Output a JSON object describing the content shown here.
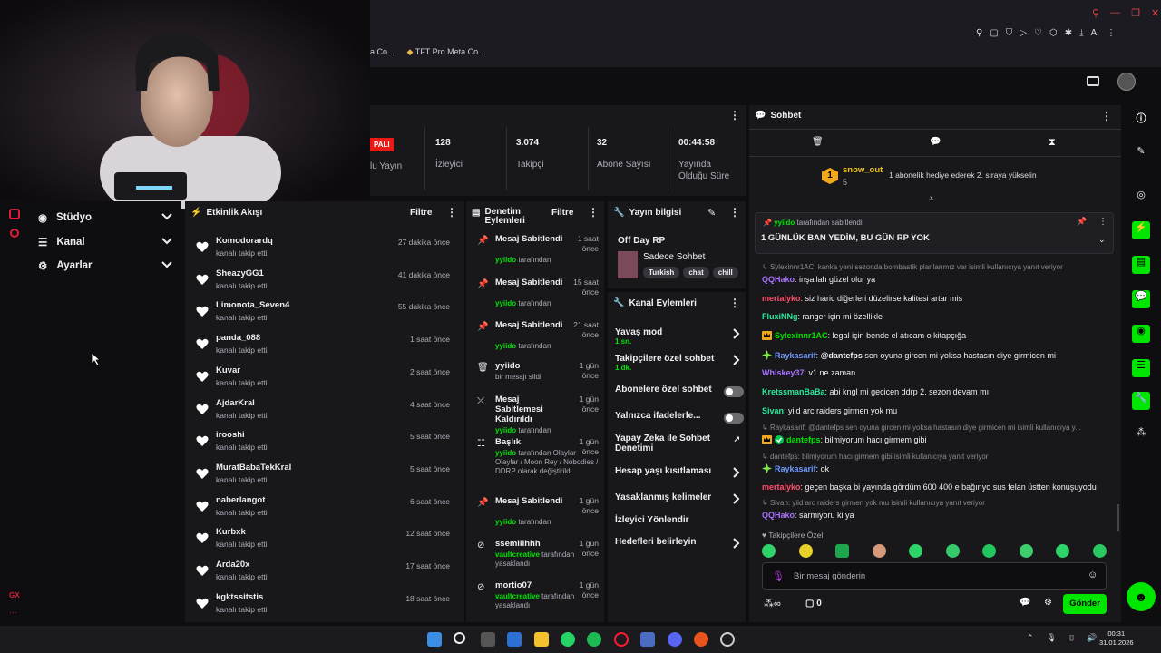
{
  "colors": {
    "accent": "#00e600",
    "purple": "#a970ff",
    "bg": "#0e0e10",
    "panel": "#18181b"
  },
  "browser": {
    "bookmarks": [
      "a Co...",
      "TFT Pro Meta Co..."
    ],
    "ai_label": "AI"
  },
  "stats": {
    "live_badge": "PALI",
    "live_label": "lu Yayın",
    "items": [
      {
        "value": "128",
        "label": "İzleyici"
      },
      {
        "value": "3.074",
        "label": "Takipçi"
      },
      {
        "value": "32",
        "label": "Abone Sayısı"
      },
      {
        "value": "00:44:58",
        "label": "Yayında Olduğu Süre"
      }
    ]
  },
  "nav": {
    "items": [
      {
        "label": "Stüdyo",
        "icon": "studio-icon"
      },
      {
        "label": "Kanal",
        "icon": "channel-icon"
      },
      {
        "label": "Ayarlar",
        "icon": "gear-icon"
      }
    ],
    "bottom_label": "GX"
  },
  "activity": {
    "title": "Etkinlik Akışı",
    "filter": "Filtre",
    "rows": [
      {
        "name": "Komodorardq",
        "sub": "kanalı takip etti",
        "time": "27 dakika önce"
      },
      {
        "name": "SheazyGG1",
        "sub": "kanalı takip etti",
        "time": "41 dakika önce"
      },
      {
        "name": "Limonota_Seven4",
        "sub": "kanalı takip etti",
        "time": "55 dakika önce"
      },
      {
        "name": "panda_088",
        "sub": "kanalı takip etti",
        "time": "1 saat önce"
      },
      {
        "name": "Kuvar",
        "sub": "kanalı takip etti",
        "time": "2 saat önce"
      },
      {
        "name": "AjdarKral",
        "sub": "kanalı takip etti",
        "time": "4 saat önce"
      },
      {
        "name": "irooshi",
        "sub": "kanalı takip etti",
        "time": "5 saat önce"
      },
      {
        "name": "MuratBabaTekKral",
        "sub": "kanalı takip etti",
        "time": "5 saat önce"
      },
      {
        "name": "naberlangot",
        "sub": "kanalı takip etti",
        "time": "6 saat önce"
      },
      {
        "name": "Kurbxk",
        "sub": "kanalı takip etti",
        "time": "12 saat önce"
      },
      {
        "name": "Arda20x",
        "sub": "kanalı takip etti",
        "time": "17 saat önce"
      },
      {
        "name": "kgktssitstis",
        "sub": "kanalı takip etti",
        "time": "18 saat önce"
      }
    ]
  },
  "moderation": {
    "title": "Denetim Eylemleri",
    "filter": "Filtre",
    "rows": [
      {
        "title": "Mesaj Sabitlendi",
        "time": "1 saat önce",
        "by_user": "yyiido",
        "by_rest": "tarafından",
        "icon": "pin-icon"
      },
      {
        "title": "Mesaj Sabitlendi",
        "time": "15 saat önce",
        "by_user": "yyiido",
        "by_rest": "tarafından",
        "icon": "pin-icon"
      },
      {
        "title": "Mesaj Sabitlendi",
        "time": "21 saat önce",
        "by_user": "yyiido",
        "by_rest": "tarafından",
        "icon": "pin-icon"
      },
      {
        "title": "yyiido",
        "time": "1 gün önce",
        "by_user": "",
        "by_rest": "bir mesajı sildi",
        "icon": "trash-icon"
      },
      {
        "title": "Mesaj Sabitlemesi Kaldırıldı",
        "time": "1 gün önce",
        "by_user": "yyiido",
        "by_rest": "tarafından",
        "icon": "unpin-icon"
      },
      {
        "title": "Başlık",
        "time": "1 gün önce",
        "by_user": "yyiido",
        "by_rest": "tarafından Olaylar Olaylar / Moon Rey / Nobodies / DDRP olarak değiştirildi",
        "icon": "title-icon"
      },
      {
        "title": "Mesaj Sabitlendi",
        "time": "1 gün önce",
        "by_user": "yyiido",
        "by_rest": "tarafından",
        "icon": "pin-icon"
      },
      {
        "title": "ssemiiihhh",
        "time": "1 gün önce",
        "by_user": "vaultcreative",
        "by_rest": "tarafından yasaklandı",
        "icon": "ban-icon"
      },
      {
        "title": "mortio07",
        "time": "1 gün önce",
        "by_user": "vaultcreative",
        "by_rest": "tarafından yasaklandı",
        "icon": "ban-icon"
      }
    ]
  },
  "stream_info": {
    "title": "Yayın bilgisi",
    "stream_title": "Off Day RP",
    "category": "Sadece Sohbet",
    "tags": [
      "Turkish",
      "chat",
      "chill"
    ]
  },
  "channel_actions": {
    "title": "Kanal Eylemleri",
    "items": [
      {
        "label": "Yavaş mod",
        "value": "1 sn.",
        "control": "arrow"
      },
      {
        "label": "Takipçilere özel sohbet",
        "value": "1 dk.",
        "control": "arrow"
      },
      {
        "label": "Abonelere özel sohbet",
        "value": "",
        "control": "toggle"
      },
      {
        "label": "Yalnızca ifadelerle...",
        "value": "",
        "control": "toggle"
      },
      {
        "label": "Yapay Zeka ile Sohbet Denetimi",
        "value": "",
        "control": "external"
      },
      {
        "label": "Hesap yaşı kısıtlaması",
        "value": "",
        "control": "arrow"
      },
      {
        "label": "Yasaklanmış kelimeler",
        "value": "",
        "control": "arrow"
      },
      {
        "label": "İzleyici Yönlendir",
        "value": "",
        "control": "none"
      },
      {
        "label": "Hedefleri belirleyin",
        "value": "",
        "control": "arrow"
      }
    ]
  },
  "chat": {
    "title": "Sohbet",
    "top_gifter": {
      "rank": "1",
      "name": "snow_out",
      "count": "5",
      "text": "1 abonelik hediye ederek 2. sıraya yükselin"
    },
    "pinned": {
      "by": "yyiido",
      "by_suffix": "tarafından sabitlendi",
      "text": "1 GÜNLÜK BAN YEDİM, BU GÜN RP YOK"
    },
    "messages": [
      {
        "type": "reply",
        "text": "Sylexinnr1AC: kanka yeni sezonda bombastik planlarımız var isimli kullanıcıya yanıt veriyor"
      },
      {
        "type": "msg",
        "user": "QQHako",
        "color": "#a970ff",
        "text": "inşallah güzel olur ya"
      },
      {
        "type": "msg",
        "user": "mertalyko",
        "color": "#ff4f6a",
        "text": "siz haric diğerleri düzelirse kalitesi artar mis"
      },
      {
        "type": "msg",
        "user": "FluxiNNg",
        "color": "#2ee89a",
        "text": "ranger için mi özellikle"
      },
      {
        "type": "msg",
        "user": "Sylexinnr1AC",
        "color": "#00e600",
        "text": "legal için bende el atıcam o kitapçığa",
        "badge": "crown"
      },
      {
        "type": "msg",
        "user": "Raykasarif",
        "color": "#6f9bff",
        "text": "@dantefps sen oyuna gircen mi yoksa hastasın diye girmicen mi",
        "badge": "star",
        "mention": "@dantefps"
      },
      {
        "type": "msg",
        "user": "Whiskey37",
        "color": "#a970ff",
        "text": "v1 ne zaman"
      },
      {
        "type": "msg",
        "user": "KretssmanBaBa",
        "color": "#2ee89a",
        "text": "abi kngl mi gecicen ddrp 2. sezon devam mı"
      },
      {
        "type": "msg",
        "user": "Sivan",
        "color": "#2ee89a",
        "text": "yiid arc raiders girmen yok mu"
      },
      {
        "type": "reply",
        "text": "Raykasarif: @dantefps sen oyuna gircen mi yoksa hastasın diye girmicen mi isimli kullanıcıya y..."
      },
      {
        "type": "msg",
        "user": "dantefps",
        "color": "#00e600",
        "text": "bilmiyorum hacı girmem gibi",
        "badge": "crown-verified"
      },
      {
        "type": "reply",
        "text": "dantefps: bilmiyorum hacı girmem gibi isimli kullanıcıya yanıt veriyor"
      },
      {
        "type": "msg",
        "user": "Raykasarif",
        "color": "#6f9bff",
        "text": "ok",
        "badge": "star"
      },
      {
        "type": "msg",
        "user": "mertalyko",
        "color": "#ff4f6a",
        "text": "geçen başka bi yayında gördüm 600 400 e bağınyo sus felan üstten konuşuyodu"
      },
      {
        "type": "reply",
        "text": "Sivan: yiid arc raiders girmen yok mu isimli kullanıcıya yanıt veriyor"
      },
      {
        "type": "msg",
        "user": "QQHako",
        "color": "#a970ff",
        "text": "sarmiyoru ki ya"
      }
    ],
    "emote_label": "Takipçilere Özel",
    "input_placeholder": "Bir mesaj gönderin",
    "points": "0",
    "send_label": "Gönder"
  },
  "taskbar": {
    "time": "00:31",
    "date": "31.01.2026"
  }
}
